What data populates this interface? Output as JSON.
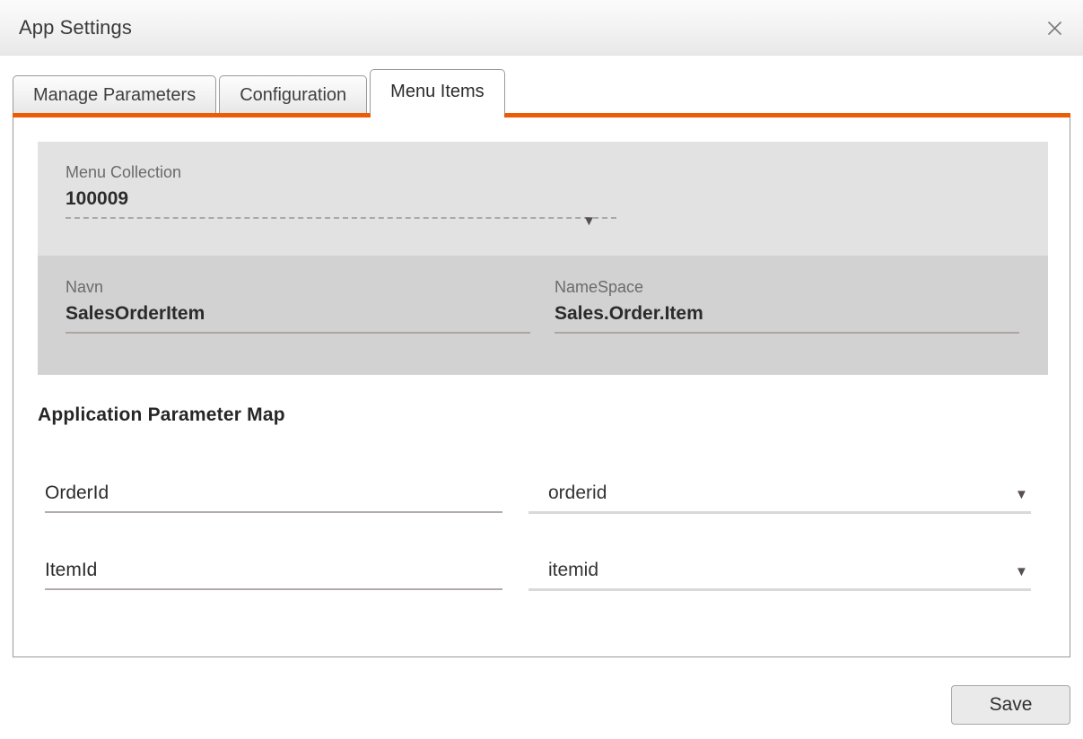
{
  "window": {
    "title": "App Settings",
    "close_icon": "close-icon",
    "accent_color": "#ec5b06"
  },
  "tabs": [
    {
      "label": "Manage Parameters",
      "active": false
    },
    {
      "label": "Configuration",
      "active": false
    },
    {
      "label": "Menu Items",
      "active": true
    }
  ],
  "menu_collection": {
    "label": "Menu Collection",
    "value": "100009",
    "dropdown_icon": "chevron-down-icon"
  },
  "details": {
    "navn": {
      "label": "Navn",
      "value": "SalesOrderItem"
    },
    "namespace": {
      "label": "NameSpace",
      "value": "Sales.Order.Item"
    }
  },
  "parameter_map": {
    "heading": "Application Parameter Map",
    "rows": [
      {
        "key": "OrderId",
        "value": "orderid",
        "dropdown_icon": "chevron-down-icon"
      },
      {
        "key": "ItemId",
        "value": "itemid",
        "dropdown_icon": "chevron-down-icon"
      }
    ]
  },
  "footer": {
    "save_label": "Save"
  }
}
